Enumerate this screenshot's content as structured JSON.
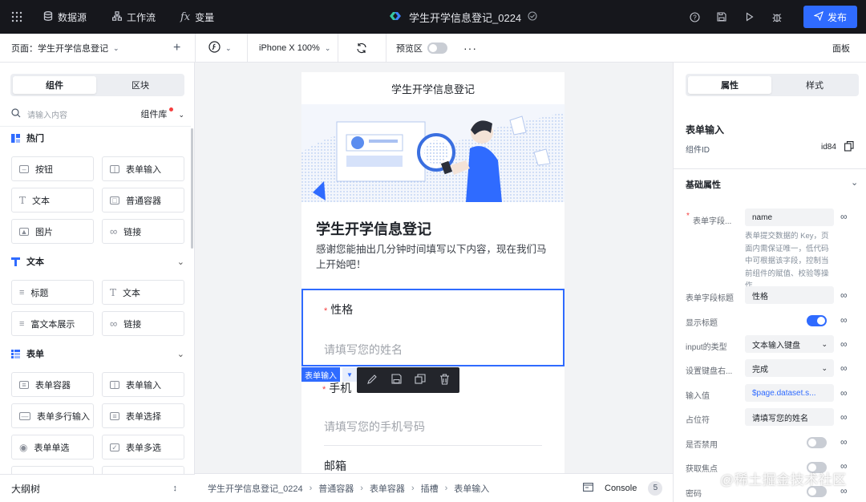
{
  "topbar": {
    "nav": [
      {
        "label": "数据源",
        "icon": "database-icon"
      },
      {
        "label": "工作流",
        "icon": "workflow-icon"
      },
      {
        "label": "变量",
        "icon": "function-icon"
      }
    ],
    "title": "学生开学信息登记_0224",
    "publish_label": "发布"
  },
  "toolbar": {
    "page_label": "页面：学生开学信息登记",
    "device": "iPhone X 100%",
    "preview_label": "预览区",
    "panel_label": "面板"
  },
  "left": {
    "tabs": [
      "组件",
      "区块"
    ],
    "search_placeholder": "请输入内容",
    "library_label": "组件库",
    "groups": [
      {
        "title": "热门",
        "items": [
          "按钮",
          "表单输入",
          "文本",
          "普通容器",
          "图片",
          "链接"
        ]
      },
      {
        "title": "文本",
        "items": [
          "标题",
          "文本",
          "富文本展示",
          "链接"
        ]
      },
      {
        "title": "表单",
        "items": [
          "表单容器",
          "表单输入",
          "表单多行输入",
          "表单选择",
          "表单单选",
          "表单多选"
        ]
      }
    ],
    "outline_label": "大纲树"
  },
  "phone": {
    "header": "学生开学信息登记",
    "title": "学生开学信息登记",
    "desc": "感谢您能抽出几分钟时间填写以下内容，现在我们马上开始吧！",
    "field1_label": "性格",
    "field1_placeholder": "请填写您的姓名",
    "sel_tag": "表单输入",
    "field2_label": "手机",
    "field2_placeholder": "请填写您的手机号码",
    "field3_label": "邮箱"
  },
  "breadcrumb": [
    "学生开学信息登记_0224",
    "普通容器",
    "表单容器",
    "插槽",
    "表单输入"
  ],
  "console": {
    "label": "Console",
    "count": "5"
  },
  "right": {
    "tabs": [
      "属性",
      "样式"
    ],
    "component_title": "表单输入",
    "id_label": "组件ID",
    "id_value": "id84",
    "section_label": "基础属性",
    "field_key_label": "表单字段...",
    "field_key_value": "name",
    "field_key_help": "表单提交数据的 Key，页面内需保证唯一，低代码中可根据该字段，控制当前组件的赋值、校验等操作",
    "title_label": "表单字段标题",
    "title_value": "性格",
    "show_title_label": "显示标题",
    "input_type_label": "input的类型",
    "input_type_value": "文本输入键盘",
    "keyboard_label": "设置键盘右...",
    "keyboard_value": "完成",
    "input_value_label": "输入值",
    "input_value_value": "$page.dataset.s...",
    "placeholder_label": "占位符",
    "placeholder_value": "请填写您的姓名",
    "disabled_label": "是否禁用",
    "focus_label": "获取焦点",
    "password_label": "密码"
  },
  "watermark": "@稀土掘金技术社区"
}
